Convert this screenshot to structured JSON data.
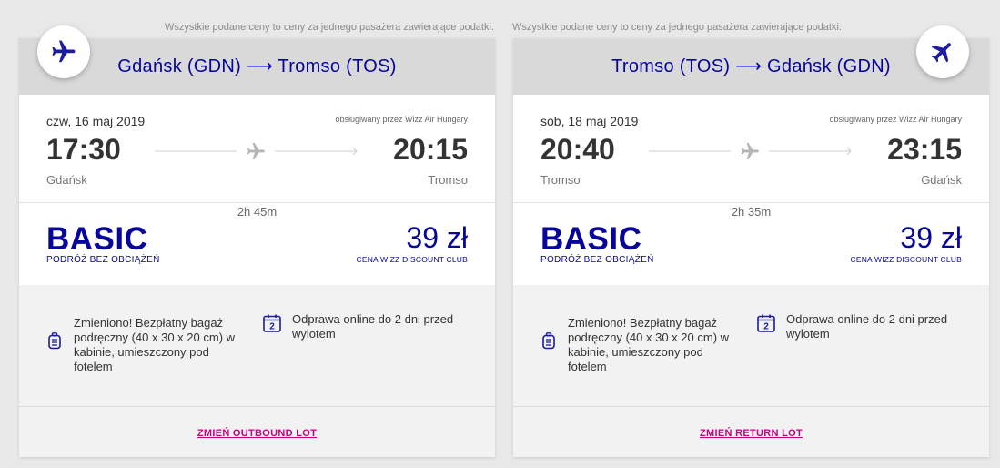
{
  "notice": "Wszystkie podane ceny to ceny za jednego pasażera zawierające podatki.",
  "colors": {
    "brand": "#06049a",
    "link": "#c6007e",
    "header": "#d9d9d9"
  },
  "outbound": {
    "route": "Gdańsk (GDN) ⟶ Tromso (TOS)",
    "date": "czw, 16 maj 2019",
    "operator": "obsługiwany przez Wizz Air Hungary",
    "dep_time": "17:30",
    "arr_time": "20:15",
    "dep_city": "Gdańsk",
    "arr_city": "Tromso",
    "duration": "2h 45m",
    "fare_name": "BASIC",
    "fare_sub": "PODRÓŻ BEZ OBCIĄŻEŃ",
    "price": "39 zł",
    "price_sub": "CENA WIZZ DISCOUNT CLUB",
    "feature_bag": "Zmieniono! Bezpłatny bagaż podręczny (40 x 30 x 20 cm) w kabinie, umieszczony pod fotelem",
    "feature_checkin": "Odprawa online do 2 dni przed wylotem",
    "calendar_num": "2",
    "change_label": "ZMIEŃ OUTBOUND LOT"
  },
  "return": {
    "route": "Tromso (TOS) ⟶ Gdańsk (GDN)",
    "date": "sob, 18 maj 2019",
    "operator": "obsługiwany przez Wizz Air Hungary",
    "dep_time": "20:40",
    "arr_time": "23:15",
    "dep_city": "Tromso",
    "arr_city": "Gdańsk",
    "duration": "2h 35m",
    "fare_name": "BASIC",
    "fare_sub": "PODRÓŻ BEZ OBCIĄŻEŃ",
    "price": "39 zł",
    "price_sub": "CENA WIZZ DISCOUNT CLUB",
    "feature_bag": "Zmieniono! Bezpłatny bagaż podręczny (40 x 30 x 20 cm) w kabinie, umieszczony pod fotelem",
    "feature_checkin": "Odprawa online do 2 dni przed wylotem",
    "calendar_num": "2",
    "change_label": "ZMIEŃ RETURN LOT"
  }
}
